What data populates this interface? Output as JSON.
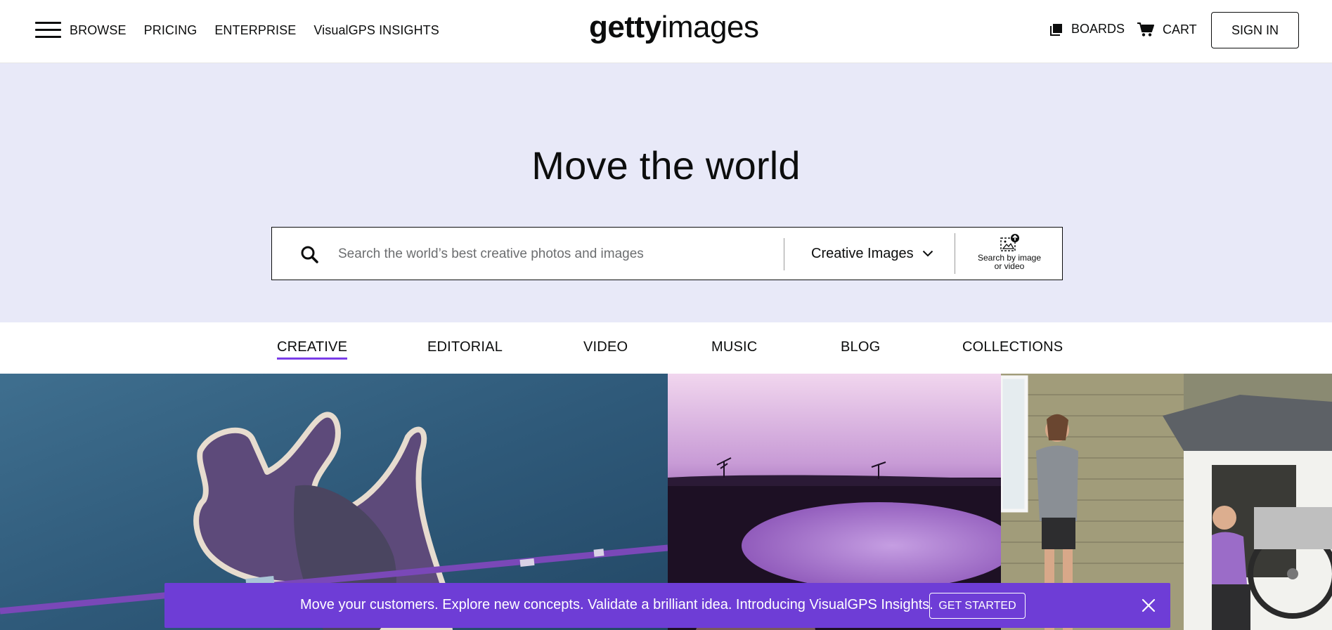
{
  "header": {
    "nav": [
      {
        "label": "BROWSE"
      },
      {
        "label": "PRICING"
      },
      {
        "label": "ENTERPRISE"
      },
      {
        "label": "VisualGPS INSIGHTS"
      }
    ],
    "logo": {
      "bold": "getty",
      "light": "images"
    },
    "boards_label": "BOARDS",
    "cart_label": "CART",
    "signin_label": "SIGN IN"
  },
  "hero": {
    "title": "Move the world",
    "search": {
      "placeholder": "Search the world’s best creative photos and images",
      "value": "",
      "type_selected": "Creative Images",
      "image_search_label": "Search by image or video"
    }
  },
  "tabs": [
    {
      "label": "CREATIVE",
      "active": true
    },
    {
      "label": "EDITORIAL"
    },
    {
      "label": "VIDEO"
    },
    {
      "label": "MUSIC"
    },
    {
      "label": "BLOG"
    },
    {
      "label": "COLLECTIONS"
    }
  ],
  "banner": {
    "text": "Move your customers. Explore new concepts. Validate a brilliant idea. Introducing VisualGPS Insights.",
    "button_label": "GET STARTED"
  },
  "colors": {
    "accent": "#6e3dd6",
    "hero_bg": "#e8e9f8",
    "tab_underline": "#7a3de8"
  },
  "icons": [
    "hamburger-icon",
    "boards-icon",
    "cart-icon",
    "search-icon",
    "chevron-down-icon",
    "image-search-icon",
    "close-icon"
  ]
}
